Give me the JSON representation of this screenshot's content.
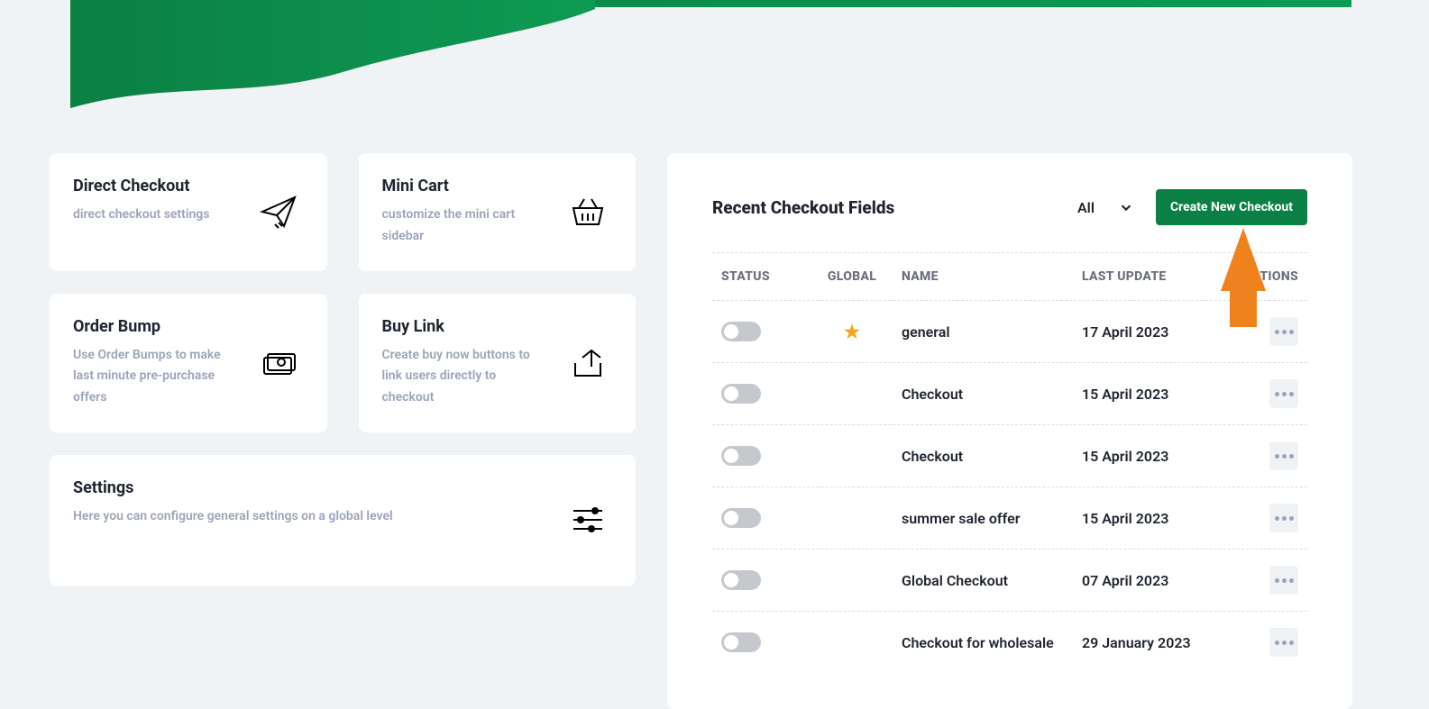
{
  "colors": {
    "brand": "#0b8044",
    "accent_arrow": "#f0821d"
  },
  "cards": {
    "direct_checkout": {
      "title": "Direct Checkout",
      "desc": "direct checkout settings"
    },
    "mini_cart": {
      "title": "Mini Cart",
      "desc": "customize the mini cart sidebar"
    },
    "order_bump": {
      "title": "Order Bump",
      "desc": "Use Order Bumps to make last minute pre-purchase offers"
    },
    "buy_link": {
      "title": "Buy Link",
      "desc": "Create buy now buttons to link users directly to checkout"
    },
    "settings": {
      "title": "Settings",
      "desc": "Here you can configure general settings on a global level"
    }
  },
  "recent": {
    "title": "Recent Checkout Fields",
    "filter_selected": "All",
    "create_label": "Create New Checkout",
    "headers": {
      "status": "STATUS",
      "global": "GLOBAL",
      "name": "NAME",
      "last_update": "LAST UPDATE",
      "actions": "ACTIONS"
    },
    "rows": [
      {
        "name": "general",
        "global": true,
        "status": false,
        "last_update": "17 April 2023"
      },
      {
        "name": "Checkout",
        "global": false,
        "status": false,
        "last_update": "15 April 2023"
      },
      {
        "name": "Checkout",
        "global": false,
        "status": false,
        "last_update": "15 April 2023"
      },
      {
        "name": "summer sale offer",
        "global": false,
        "status": false,
        "last_update": "15 April 2023"
      },
      {
        "name": "Global Checkout",
        "global": false,
        "status": false,
        "last_update": "07 April 2023"
      },
      {
        "name": "Checkout for wholesale",
        "global": false,
        "status": false,
        "last_update": "29 January 2023"
      }
    ]
  }
}
